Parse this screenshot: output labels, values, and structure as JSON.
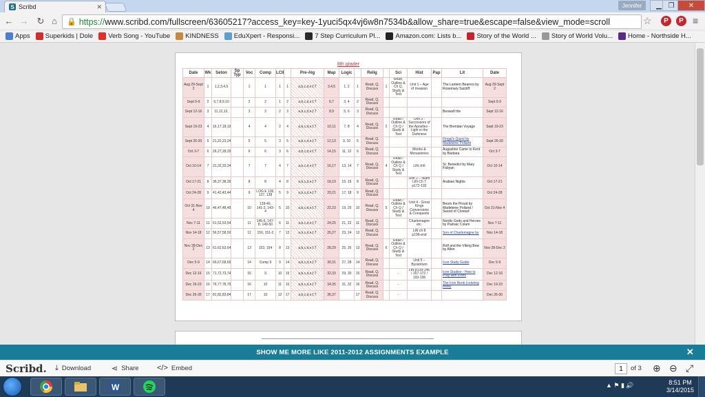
{
  "browser": {
    "tab_title": "Scribd",
    "user_name": "Jennifer",
    "url_scheme": "https://",
    "url_rest": "www.scribd.com/fullscreen/63605217?access_key=key-1yuci5qx4vj6w8n7534b&allow_share=true&escape=false&view_mode=scroll"
  },
  "bookmarks": [
    {
      "label": "Apps",
      "color": "#4a7fd4"
    },
    {
      "label": "Superkids | Dole",
      "color": "#d42b2b"
    },
    {
      "label": "Verb Song - YouTube",
      "color": "#e52d27"
    },
    {
      "label": "KINDNESS",
      "color": "#c78a3a"
    },
    {
      "label": "EduXpert - Responsi...",
      "color": "#5aa0d0"
    },
    {
      "label": "7 Step Curriculum Pl...",
      "color": "#2a2a2a"
    },
    {
      "label": "Amazon.com: Lists b...",
      "color": "#222222"
    },
    {
      "label": "Story of the World ...",
      "color": "#c8232c"
    },
    {
      "label": "Story of World Volu...",
      "color": "#999999"
    },
    {
      "label": "Home - Northside H...",
      "color": "#5a2a8a"
    }
  ],
  "doc": {
    "title": "8th grader",
    "headers": [
      "Date",
      "Wk",
      "Seton",
      "Sp Typ",
      "Voc",
      "Comp",
      "LCII",
      "",
      "Pre-Alg",
      "Map",
      "Logic",
      "",
      "Relig",
      "",
      "Sci",
      "Hist",
      "Pap",
      "Lit",
      "Date"
    ],
    "rows": [
      [
        "Aug 29-Sept 2",
        "1",
        "1,2,3,4,5",
        "",
        "1",
        "1",
        "1",
        "1",
        "a,b,c,d,e,f,T",
        "3,4,5",
        "1, 2",
        "1",
        "Read, Q, Discuss",
        "1",
        "Read, Outline & Ch Q, Study & Test",
        "Unit 1 – Age of Invasion",
        "",
        "The Lantern Bearers by Rosemary Sutcliff",
        "Aug 29-Sept 2"
      ],
      [
        "Sept 5-9",
        "2",
        "6,7,8,9,10",
        "",
        "2",
        "2",
        "1",
        "2",
        "a,b,c,d,e,f,T",
        "6,7",
        "3, 4",
        "2",
        "Read, Q, Discuss",
        "",
        "",
        "",
        "",
        "",
        "Sept 5-9"
      ],
      [
        "Sept 12-16",
        "3",
        "11,12,13,",
        "",
        "3",
        "3",
        "2",
        "3",
        "a,b,c,d,e,f,T",
        "8,9",
        "5, 6",
        "3",
        "Read, Q, Discuss",
        "",
        "",
        "",
        "",
        "Beowulf the",
        "Sept 12-16"
      ],
      [
        "Sept 19-23",
        "4",
        "16,17,18,19,20",
        "",
        "4",
        "4",
        "2",
        "4",
        "a,b,c,d,e,f,T",
        "10,11",
        "7, 8",
        "4",
        "Read, Q, Discuss",
        "2",
        "Read / Outline & Ch Q / Study & Test",
        "Unit 3 - Successors of the Apostles - Light in the Darkness",
        "",
        "The Brendan Voyage",
        "Sept 19-23"
      ],
      [
        "Sept 26-30",
        "5",
        "21,22,23,24,25",
        "",
        "5",
        "5",
        "3",
        "5",
        "a,b,c,d,e,f,T",
        "12,13",
        "9, 10",
        "5",
        "Read, Q, Discuss",
        "",
        "",
        "",
        "",
        "Fingal's Quest by Madeleine Polland",
        "Sept 26-30"
      ],
      [
        "Oct 3-7",
        "6",
        "26,27,28,29,30",
        "",
        "6",
        "6",
        "3",
        "6",
        "a,b,c,d,e,f,T",
        "14,15",
        "11, 12",
        "6",
        "Read, Q, Discuss",
        "",
        "",
        "Monks & Monasteries",
        "",
        "Augustine Came to Kent by Barbara",
        "Oct 3-7"
      ],
      [
        "Oct 10-14",
        "7",
        "31,32,33,34,35",
        "",
        "7",
        "7",
        "4",
        "7",
        "a,b,c,d,e,f,T",
        "16,17",
        "13, 14",
        "7",
        "Read, Q, Discuss",
        "4",
        "Read / Outline & Ch Q / Study & Test",
        "LtN ch6",
        "",
        "St. Benedict by Mary Fabyan",
        "Oct 10-14"
      ],
      [
        "Oct 17-21",
        "8",
        "36,37,38,39,40",
        "",
        "8",
        "8",
        "4",
        "8",
        "a,b,c,d,e,f,T",
        "18,19",
        "15, 16",
        "8",
        "Read, Q, Discuss",
        "",
        "",
        "Unit 2 – Islam LtN Ch 7 p172-192",
        "",
        "Arabian Nights",
        "Oct 17-21"
      ],
      [
        "Oct 24-28",
        "9",
        "41,42,43,44,45",
        "",
        "9",
        "LOG E 136, 137, 138",
        "5",
        "9",
        "a,b,c,d,e,f,T",
        "20,21",
        "17, 18",
        "9",
        "Read, Q, Discuss",
        "",
        "",
        "",
        "",
        "",
        "Oct 24-28"
      ],
      [
        "Oct 31-Nov 4",
        "10",
        "46,47,48,49,50",
        "",
        "10",
        "139-40, 141-2, 143-4",
        "5",
        "10",
        "a,b,c,d,e,f,T",
        "22,23",
        "19, 20",
        "10",
        "Read, Q, Discuss",
        "5",
        "Read / Outline & Ch Q / Study & Test",
        "Unit 4 - Great Kings Conversions & Conquests",
        "",
        "Beorn the Proud by Madeleine Polland / Sword of Clontarf",
        "Oct 31-Nov 4"
      ],
      [
        "Nov 7-11",
        "11",
        "51,52,53,54,55",
        "",
        "11",
        "145-6, 147-8, 149-50",
        "6",
        "11",
        "a,b,c,d,e,f,T",
        "24,25",
        "21, 22",
        "11",
        "Read, Q, Discuss",
        "",
        "",
        "Charlemagne etc.",
        "",
        "Nordic Gods and Heroes by Padraic Colum",
        "Nov 7-11"
      ],
      [
        "Nov 14-18",
        "12",
        "56,57,58,59,60",
        "",
        "12",
        "150, 151-2",
        "7",
        "12",
        "a,b,c,d,e,f,T",
        "26,27",
        "23, 24",
        "12",
        "Read, Q, Discuss",
        "",
        "",
        "LtN ch 8 p196-end",
        "",
        "Son of Charlemagne by",
        "Nov 14-18"
      ],
      [
        "Nov 28-Dec 2",
        "13",
        "61,62,63,64,65",
        "",
        "13",
        "153, 154",
        "8",
        "13",
        "a,b,c,d,e,f,T",
        "28,29",
        "25, 26",
        "13",
        "Read, Q, Discuss",
        "6",
        "Read / Outline & Ch Q / Study & Test",
        "",
        "",
        "Rolf and the Viking Bow by Allen",
        "Nov 28-Dec 2"
      ],
      [
        "Dec 5-9",
        "14",
        "66,67,68,69,70",
        "",
        "14",
        "Comp 9",
        "9",
        "14",
        "a,b,c,d,e,f,T",
        "30,31",
        "27, 28",
        "14",
        "Read, Q, Discuss",
        "",
        "",
        "Unit 5 – Byzantium",
        "",
        "Icon Study Guide",
        "Dec 5-9"
      ],
      [
        "Dec 12-16",
        "15",
        "71,72,73,74,75",
        "",
        "15",
        "9",
        "10",
        "15",
        "a,b,c,d,e,f,T",
        "32,33",
        "29, 30",
        "15",
        "Read, Q, Discuss",
        "",
        "-",
        "LtN p139-146 / 167-172 / 193-196",
        "",
        "Icon Studies - How to Pray with Icons",
        "Dec 12-16"
      ],
      [
        "Dec 19-23",
        "16",
        "76,77,78,79,80",
        "",
        "16",
        "10",
        "11",
        "16",
        "a,b,c,d,e,f,T",
        "34,35",
        "31, 32",
        "16",
        "Read, Q, Discuss",
        "",
        "-",
        "",
        "",
        "The Icon Book (coloring book)",
        "Dec 19-23"
      ],
      [
        "Dec 26-30",
        "17",
        "81,82,83,84,85",
        "",
        "17",
        "10",
        "12",
        "17",
        "a,b,c,d,e,f,T",
        "36,37",
        "",
        "17",
        "Read, Q, Discuss",
        "",
        "-",
        "",
        "",
        "",
        "Dec 26-30"
      ]
    ]
  },
  "promo": {
    "text": "SHOW ME MORE LIKE 2011-2012 ASSIGNMENTS EXAMPLE",
    "close": "✕"
  },
  "scribd_bar": {
    "logo": "Scribd.",
    "download": "Download",
    "share": "Share",
    "embed": "Embed",
    "page": "1",
    "of": "of 3"
  },
  "taskbar": {
    "time": "8:51 PM",
    "date": "3/14/2015"
  }
}
